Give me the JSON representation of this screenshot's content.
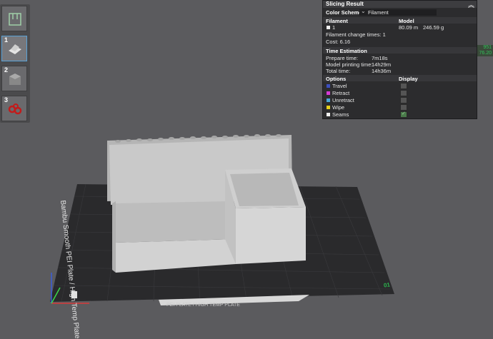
{
  "panel": {
    "title": "Slicing Result",
    "color_scheme_label": "Color Scheme",
    "color_scheme_value": "Filament",
    "filament_header": "Filament",
    "model_header": "Model",
    "filament_id": "1",
    "model_length": "80.09 m",
    "model_weight": "246.59 g",
    "filament_change": "Filament change times:  1",
    "cost": "Cost:  6.16",
    "time_header": "Time Estimation",
    "prepare_label": "Prepare time:",
    "prepare_value": "7m18s",
    "model_print_label": "Model printing time:",
    "model_print_value": "14h29m",
    "total_label": "Total time:",
    "total_value": "14h36m",
    "options_header": "Options",
    "display_header": "Display",
    "options": [
      {
        "label": "Travel",
        "color": "#3c4fbf",
        "checked": false
      },
      {
        "label": "Retract",
        "color": "#d63ad6",
        "checked": false
      },
      {
        "label": "Unretract",
        "color": "#4aa8d8",
        "checked": false
      },
      {
        "label": "Wipe",
        "color": "#e8d21a",
        "checked": false
      },
      {
        "label": "Seams",
        "color": "#f0f0f0",
        "checked": true
      }
    ]
  },
  "sidebar": {
    "plates": [
      {
        "num": "1",
        "active": true
      },
      {
        "num": "2",
        "active": false
      },
      {
        "num": "3",
        "active": false
      }
    ]
  },
  "readout": {
    "line1": "951",
    "line2": "76.20"
  },
  "bed": {
    "side_text": "Bambu Smooth PEI Plate / High Temp Plate",
    "front_text": "PEI PLATE / HIGH TEMP PLATE",
    "axis_number": "01"
  },
  "colors": {
    "background": "#5b5b5e",
    "accent": "#59a1d6",
    "panel": "#2c2c2e",
    "model": "#c8c8c8"
  }
}
